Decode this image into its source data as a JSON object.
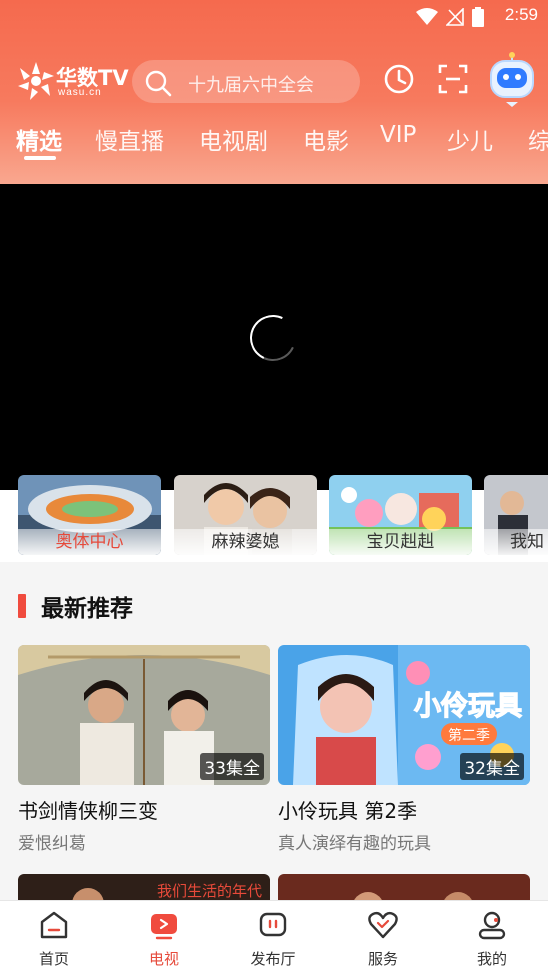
{
  "status": {
    "time": "2:59"
  },
  "header": {
    "logo_text": "华数TV",
    "logo_sub": "wasu.cn",
    "search_placeholder": "十九届六中全会"
  },
  "tabs": [
    {
      "label": "精选",
      "active": true
    },
    {
      "label": "慢直播"
    },
    {
      "label": "电视剧"
    },
    {
      "label": "电影"
    },
    {
      "label": "VIP"
    },
    {
      "label": "少儿"
    },
    {
      "label": "综"
    }
  ],
  "strip": [
    {
      "label": "奥体中心",
      "active": true
    },
    {
      "label": "麻辣婆媳"
    },
    {
      "label": "宝贝赳赳"
    },
    {
      "label": "我知"
    }
  ],
  "section": {
    "title": "最新推荐"
  },
  "cards": [
    {
      "title": "书剑情侠柳三变",
      "subtitle": "爱恨纠葛",
      "badge": "33集全"
    },
    {
      "title": "小伶玩具 第2季",
      "subtitle": "真人演绎有趣的玩具",
      "badge": "32集全",
      "art_text": "小伶玩具",
      "art_sub": "第二季"
    }
  ],
  "card2_art_text": "我们生活的年代",
  "bottom_nav": [
    {
      "label": "首页"
    },
    {
      "label": "电视",
      "active": true
    },
    {
      "label": "发布厅"
    },
    {
      "label": "服务"
    },
    {
      "label": "我的"
    }
  ],
  "colors": {
    "accent": "#f04b3e",
    "header_top": "#f56a4e",
    "header_bottom": "#f9a78f"
  }
}
